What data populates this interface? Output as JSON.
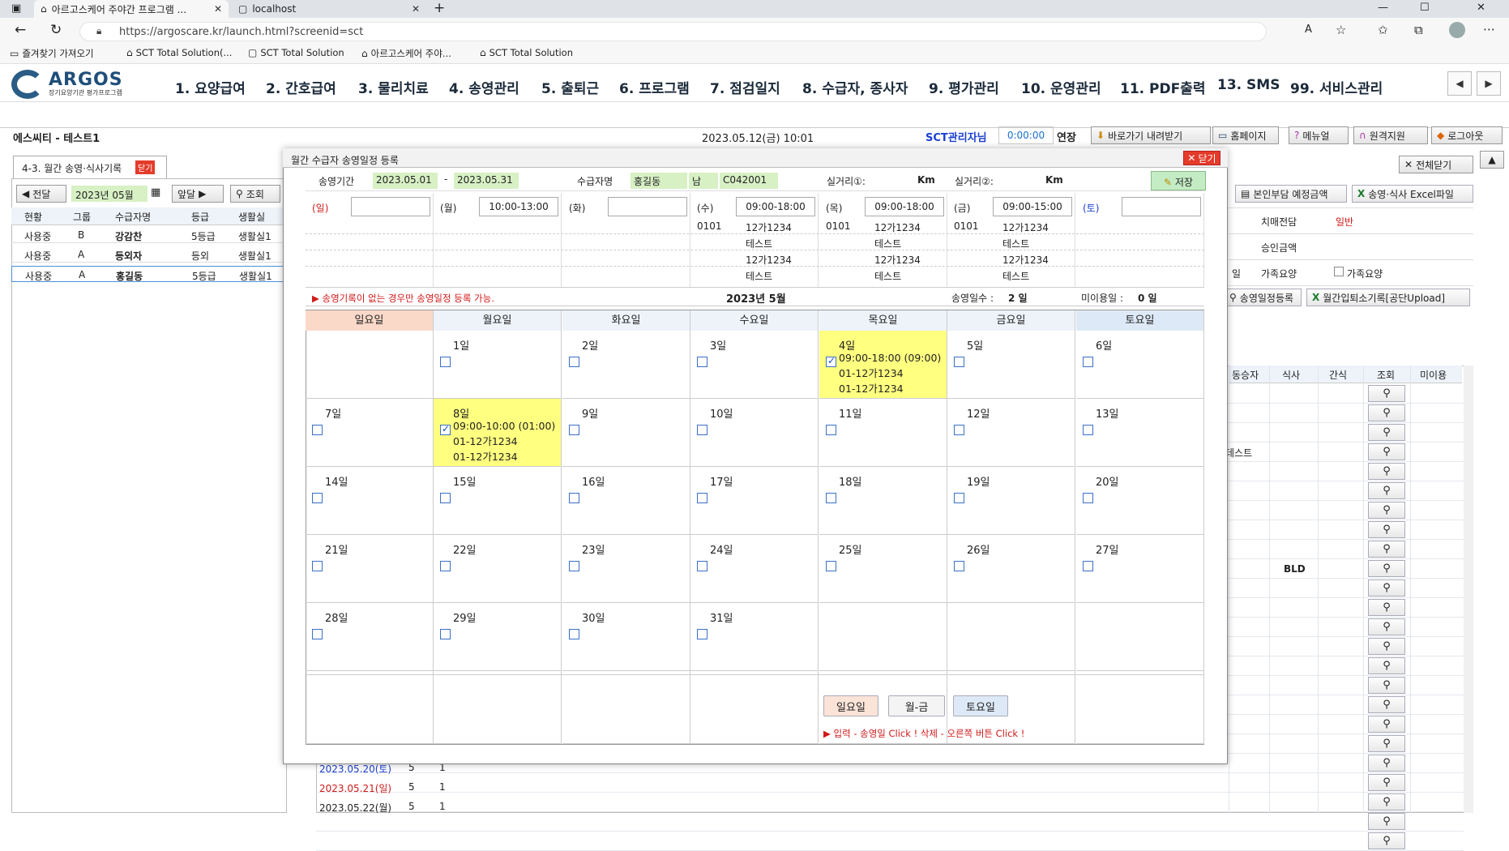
{
  "browser": {
    "tabs": [
      {
        "label": "아르고스케어 주야간 프로그램 ..."
      },
      {
        "label": "localhost"
      }
    ],
    "url": "https://argoscare.kr/launch.html?screenid=sct",
    "bookmarks": [
      "즐겨찾기 가져오기",
      "SCT Total Solution(...",
      "SCT Total Solution",
      "아르고스케어 주야...",
      "SCT Total Solution"
    ]
  },
  "app": {
    "logo_text": "ARGOS",
    "logo_sub": "장기요양기관 평가프로그램",
    "menu": [
      "1. 요양급여",
      "2. 간호급여",
      "3. 물리치료",
      "4. 송영관리",
      "5. 출퇴근",
      "6. 프로그램",
      "7. 점검일지",
      "8. 수급자, 종사자",
      "9. 평가관리",
      "10. 운영관리",
      "11. PDF출력",
      "13. SMS",
      "99. 서비스관리"
    ],
    "org": "에스씨티 - 테스트1",
    "datetime": "2023.05.12(금) 10:01",
    "user": "SCT관리자님",
    "timer": "0:00:00",
    "extend": "연장",
    "buttons": {
      "shortcut": "바로가기 내려받기",
      "homepage": "홈페이지",
      "manual": "메뉴얼",
      "remote": "원격지원",
      "logout": "로그아웃"
    }
  },
  "left": {
    "tab_label": "4-3. 월간 송영·식사기록",
    "tab_close": "닫기",
    "prev": "전달",
    "month": "2023년 05월",
    "next": "앞달",
    "search": "조회",
    "headers": [
      "현황",
      "그룹",
      "수급자명",
      "등급",
      "생활실"
    ],
    "rows": [
      {
        "status": "사용중",
        "group": "B",
        "name": "강감찬",
        "grade": "5등급",
        "room": "생활실1"
      },
      {
        "status": "사용중",
        "group": "A",
        "name": "등외자",
        "grade": "등외",
        "room": "생활실1"
      },
      {
        "status": "사용중",
        "group": "A",
        "name": "홍길동",
        "grade": "5등급",
        "room": "생활실1"
      }
    ]
  },
  "right": {
    "close_all": "전체닫기",
    "copay": "본인부담 예정금액",
    "excel": "송영·식사 Excel파일",
    "dementia_label": "치매전담",
    "dementia_value": "일반",
    "approved_label": "승인금액",
    "family_prefix": "일",
    "family_label": "가족요양",
    "family_check": "가족요양",
    "schedule_btn": "송영일정등록",
    "upload_btn": "월간입퇴소기록[공단Upload]",
    "grid_headers": [
      "동승자",
      "식사",
      "간식",
      "조회",
      "미이용"
    ],
    "cell_test": "테스트",
    "cell_bld": "BLD",
    "bottom_rows": [
      {
        "date": "2023.05.20(토)",
        "a": "5",
        "b": "1",
        "color": "#1a3fd0"
      },
      {
        "date": "2023.05.21(일)",
        "a": "5",
        "b": "1",
        "color": "#d01a1a"
      },
      {
        "date": "2023.05.22(월)",
        "a": "5",
        "b": "1",
        "color": "#222"
      }
    ]
  },
  "modal": {
    "title": "월간 수급자 송영일정 등록",
    "close": "닫기",
    "period_label": "송영기간",
    "period_from": "2023.05.01",
    "period_sep": "-",
    "period_to": "2023.05.31",
    "name_label": "수급자명",
    "name": "홍길동",
    "gender": "남",
    "code": "C042001",
    "dist1_label": "실거리①:",
    "dist1_unit": "Km",
    "dist2_label": "실거리②:",
    "dist2_unit": "Km",
    "save": "저장",
    "weekdays": [
      {
        "label": "(일)",
        "time": "",
        "color": "#d01a1a"
      },
      {
        "label": "(월)",
        "time": "10:00-13:00",
        "color": "#222"
      },
      {
        "label": "(화)",
        "time": "",
        "color": "#222"
      },
      {
        "label": "(수)",
        "time": "09:00-18:00",
        "color": "#222"
      },
      {
        "label": "(목)",
        "time": "09:00-18:00",
        "color": "#222"
      },
      {
        "label": "(금)",
        "time": "09:00-15:00",
        "color": "#222"
      },
      {
        "label": "(토)",
        "time": "",
        "color": "#1a3fd0"
      }
    ],
    "vehicle_code": "0101",
    "vehicle_no": "12가1234",
    "driver": "테스트",
    "notice": "▶ 송영기록이 없는 경우만 송영일정 등록 가능.",
    "month_title": "2023년  5월",
    "days_label": "송영일수 :",
    "days_value": "2 일",
    "unused_label": "미이용일 :",
    "unused_value": "0 일",
    "day_headers": [
      "일요일",
      "월요일",
      "화요일",
      "수요일",
      "목요일",
      "금요일",
      "토요일"
    ],
    "day_suffix": "일",
    "events": {
      "4": [
        "09:00-18:00 (09:00)",
        "01-12가1234",
        "01-12가1234"
      ],
      "8": [
        "09:00-10:00 (01:00)",
        "01-12가1234",
        "01-12가1234"
      ]
    },
    "btn_sun": "일요일",
    "btn_week": "월-금",
    "btn_sat": "토요일",
    "help": "▶ 입력 - 송영일 Click ! 삭제 - 오른쪽 버튼 Click !"
  }
}
